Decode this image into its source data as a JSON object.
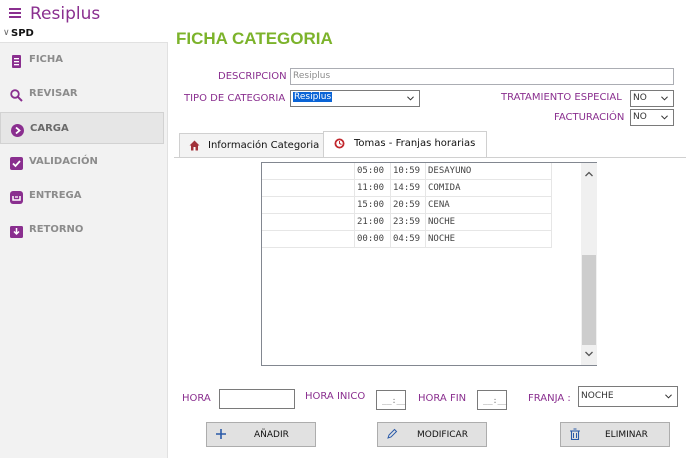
{
  "app": {
    "title": "Resiplus",
    "menu_icon": "hamburger-icon",
    "accent_color": "#8a2f8f"
  },
  "sidebar": {
    "group_label": "SPD",
    "items": [
      {
        "label": "FICHA",
        "icon": "document-icon",
        "active": false
      },
      {
        "label": "REVISAR",
        "icon": "search-icon",
        "active": false
      },
      {
        "label": "CARGA",
        "icon": "arrow-right-circle-icon",
        "active": true
      },
      {
        "label": "VALIDACIÓN",
        "icon": "check-box-icon",
        "active": false
      },
      {
        "label": "ENTREGA",
        "icon": "inbox-icon",
        "active": false
      },
      {
        "label": "RETORNO",
        "icon": "return-icon",
        "active": false
      }
    ]
  },
  "page": {
    "title": "FICHA CATEGORIA",
    "title_color": "#7cb32b"
  },
  "form": {
    "descripcion_label": "DESCRIPCION",
    "descripcion_value": "Resiplus",
    "tipo_label": "TIPO DE CATEGORIA",
    "tipo_value": "Resiplus",
    "tratamiento_label": "TRATAMIENTO ESPECIAL",
    "tratamiento_value": "NO",
    "facturacion_label": "FACTURACIÓN",
    "facturacion_value": "NO"
  },
  "tabs": [
    {
      "label": "Información Categoria",
      "icon": "home-icon",
      "active": false
    },
    {
      "label": "Tomas - Franjas horarias",
      "icon": "clock-icon",
      "active": true
    }
  ],
  "franjas": {
    "rows": [
      {
        "inicio": "05:00",
        "fin": "10:59",
        "nombre": "DESAYUNO"
      },
      {
        "inicio": "11:00",
        "fin": "14:59",
        "nombre": "COMIDA"
      },
      {
        "inicio": "15:00",
        "fin": "20:59",
        "nombre": "CENA"
      },
      {
        "inicio": "21:00",
        "fin": "23:59",
        "nombre": "NOCHE"
      },
      {
        "inicio": "00:00",
        "fin": "04:59",
        "nombre": "NOCHE"
      }
    ]
  },
  "bottom_form": {
    "hora_label": "HORA",
    "hora_value": "",
    "hora_inicio_label": "HORA INICO",
    "hora_inicio_mask": "__:__",
    "hora_fin_label": "HORA FIN",
    "hora_fin_mask": "__:__",
    "franja_label": "FRANJA :",
    "franja_value": "NOCHE"
  },
  "buttons": {
    "add_label": "AÑADIR",
    "modify_label": "MODIFICAR",
    "delete_label": "ELIMINAR"
  }
}
